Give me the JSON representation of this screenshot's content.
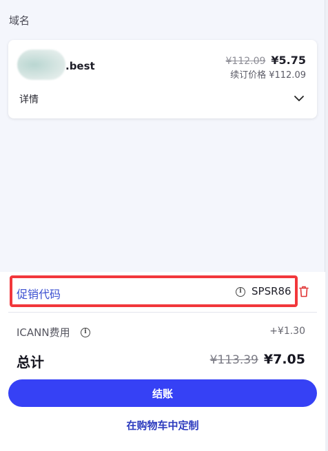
{
  "section": {
    "title": "域名"
  },
  "domain_card": {
    "domain_suffix": ".best",
    "price_old": "¥112.09",
    "price_new": "¥5.75",
    "renew_text": "续订价格 ¥112.09",
    "details_label": "详情"
  },
  "promo": {
    "label": "促销代码",
    "code": "SPSR86",
    "highlight_color": "#f2373b"
  },
  "fees": {
    "icann_label": "ICANN费用",
    "icann_amount": "+¥1.30"
  },
  "total": {
    "label": "总计",
    "old": "¥113.39",
    "new": "¥7.05"
  },
  "actions": {
    "checkout_label": "结账",
    "customize_label": "在购物车中定制",
    "accent_color": "#3641f5"
  }
}
